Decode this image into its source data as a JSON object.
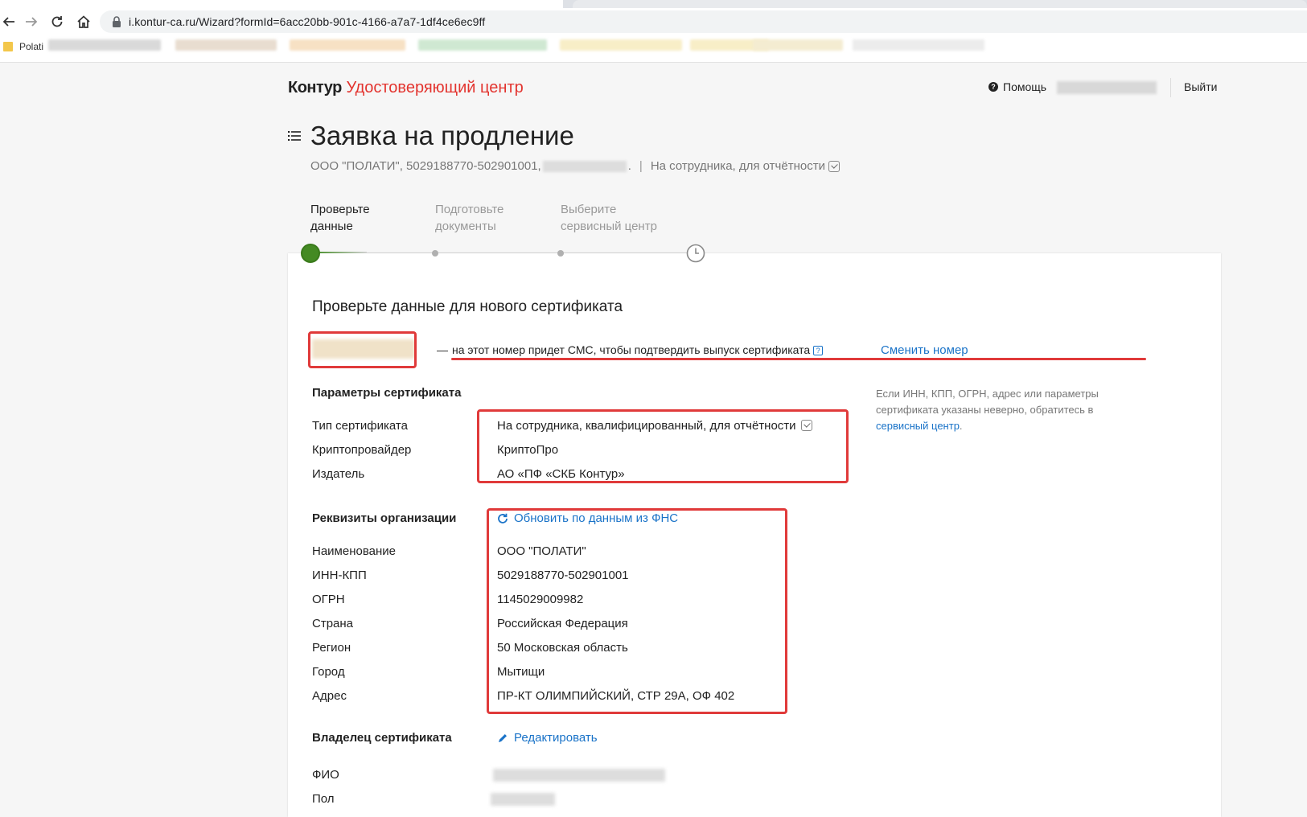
{
  "browser": {
    "url": "i.kontur-ca.ru/Wizard?formId=6acc20bb-901c-4166-a7a7-1df4ce6ec9ff",
    "bookmark_folder": "Polati"
  },
  "header": {
    "brand": "Контур",
    "product": "Удостоверяющий центр",
    "help": "Помощь",
    "logout": "Выйти"
  },
  "page": {
    "title": "Заявка на продление",
    "subtitle_org": "ООО \"ПОЛАТИ\", 5029188770-502901001,",
    "subtitle_dot": ".",
    "subtitle_sep": "|",
    "subtitle_type": "На сотрудника, для отчётности"
  },
  "steps": [
    {
      "line1": "Проверьте",
      "line2": "данные"
    },
    {
      "line1": "Подготовьте",
      "line2": "документы"
    },
    {
      "line1": "Выберите",
      "line2": "сервисный центр"
    }
  ],
  "card": {
    "title": "Проверьте данные для нового сертификата",
    "phone_dash": "—",
    "phone_note": "на этот номер придет СМС, чтобы подтвердить выпуск сертификата",
    "phone_help": "?",
    "change_phone": "Сменить номер",
    "hint_text": "Если ИНН, КПП, ОГРН, адрес или параметры сертификата указаны неверно, обратитесь в ",
    "hint_link": "сервисный центр",
    "hint_end": ".",
    "cert_params": {
      "title": "Параметры сертификата",
      "rows": [
        {
          "label": "Тип сертификата",
          "value": "На сотрудника, квалифицированный, для отчётности"
        },
        {
          "label": "Криптопровайдер",
          "value": "КриптоПро"
        },
        {
          "label": "Издатель",
          "value": "АО «ПФ «СКБ Контур»"
        }
      ]
    },
    "org": {
      "title": "Реквизиты организации",
      "refresh": "Обновить по данным из ФНС",
      "rows": [
        {
          "label": "Наименование",
          "value": "ООО \"ПОЛАТИ\""
        },
        {
          "label": "ИНН-КПП",
          "value": "5029188770-502901001"
        },
        {
          "label": "ОГРН",
          "value": "1145029009982"
        },
        {
          "label": "Страна",
          "value": "Российская Федерация"
        },
        {
          "label": "Регион",
          "value": "50 Московская область"
        },
        {
          "label": "Город",
          "value": "Мытищи"
        },
        {
          "label": "Адрес",
          "value": "ПР-КТ ОЛИМПИЙСКИЙ, СТР 29А, ОФ 402"
        }
      ]
    },
    "owner": {
      "title": "Владелец сертификата",
      "edit": "Редактировать",
      "rows": [
        {
          "label": "ФИО"
        },
        {
          "label": "Пол"
        }
      ]
    }
  },
  "colors": {
    "accent_red": "#e3342f",
    "link_blue": "#1a73c8",
    "step_green": "#448a23"
  }
}
